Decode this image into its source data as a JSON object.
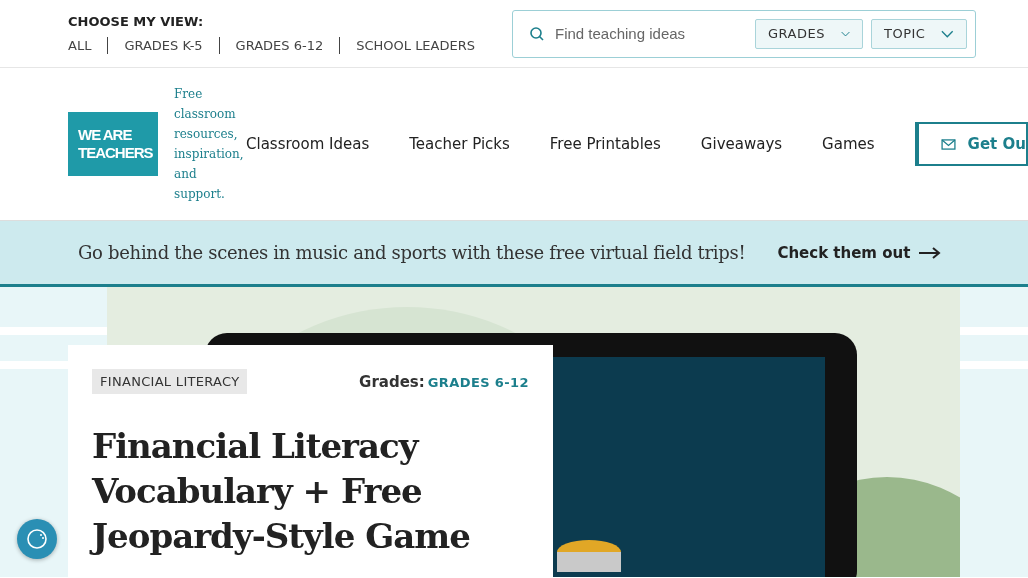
{
  "view_chooser": {
    "label": "CHOOSE MY VIEW:",
    "options": [
      {
        "label": "ALL",
        "selected": false
      },
      {
        "label": "GRADES K-5",
        "selected": false
      },
      {
        "label": "GRADES 6-12",
        "selected": false
      },
      {
        "label": "SCHOOL LEADERS",
        "selected": false
      }
    ]
  },
  "search": {
    "placeholder": "Find teaching ideas",
    "filters": [
      "GRADES",
      "TOPIC"
    ]
  },
  "logo": {
    "lines": [
      "WE ARE",
      "TEACHERS"
    ],
    "tagline": "Free classroom resources, inspiration, and support."
  },
  "nav": {
    "items": [
      "Classroom Ideas",
      "Teacher Picks",
      "Free Printables",
      "Giveaways",
      "Games"
    ],
    "cta": "Get Ou"
  },
  "banner": {
    "text": "Go behind the scenes in music and sports with these free virtual field trips!",
    "link": "Check them out"
  },
  "article": {
    "category": "FINANCIAL LITERACY",
    "grades_label": "Grades:",
    "grades": "GRADES 6-12",
    "title": "Financial Literacy Vocabulary + Free Jeopardy-Style Game"
  }
}
